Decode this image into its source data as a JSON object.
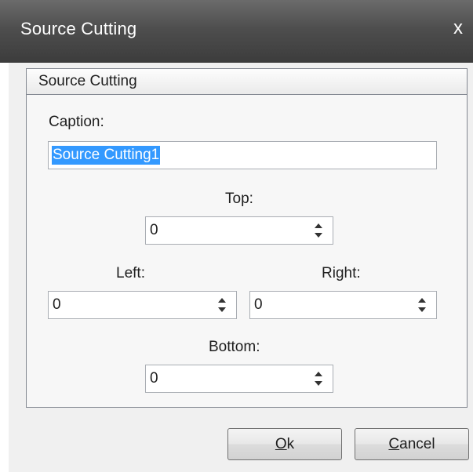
{
  "window": {
    "title": "Source Cutting",
    "close_glyph": "x"
  },
  "group": {
    "header": "Source Cutting"
  },
  "caption": {
    "label": "Caption:",
    "value": "Source Cutting1"
  },
  "fields": {
    "top": {
      "label": "Top:",
      "value": "0"
    },
    "left": {
      "label": "Left:",
      "value": "0"
    },
    "right": {
      "label": "Right:",
      "value": "0"
    },
    "bottom": {
      "label": "Bottom:",
      "value": "0"
    }
  },
  "buttons": {
    "ok": {
      "mnemonic": "O",
      "rest": "k"
    },
    "cancel": {
      "mnemonic": "C",
      "rest": "ancel"
    }
  },
  "icons": {
    "close": "close-icon",
    "spinner": "spinner-arrows-icon"
  },
  "colors": {
    "titlebar": "#4e4e4e",
    "selection": "#3399ff",
    "client_bg": "#f0f0f0"
  }
}
